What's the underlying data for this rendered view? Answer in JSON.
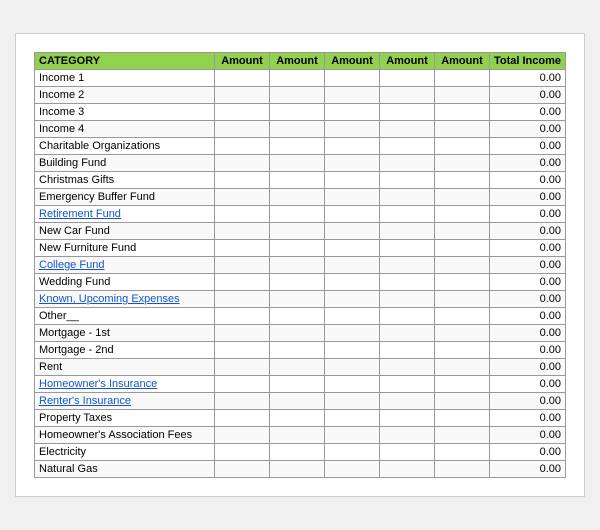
{
  "table": {
    "headers": [
      "CATEGORY",
      "Amount",
      "Amount",
      "Amount",
      "Amount",
      "Amount",
      "Total Income"
    ],
    "rows": [
      {
        "category": "Income 1",
        "link": false,
        "amounts": [
          "",
          "",
          "",
          "",
          ""
        ],
        "total": "0.00"
      },
      {
        "category": "Income 2",
        "link": false,
        "amounts": [
          "",
          "",
          "",
          "",
          ""
        ],
        "total": "0.00"
      },
      {
        "category": "Income 3",
        "link": false,
        "amounts": [
          "",
          "",
          "",
          "",
          ""
        ],
        "total": "0.00"
      },
      {
        "category": "Income 4",
        "link": false,
        "amounts": [
          "",
          "",
          "",
          "",
          ""
        ],
        "total": "0.00"
      },
      {
        "category": "Charitable Organizations",
        "link": false,
        "amounts": [
          "",
          "",
          "",
          "",
          ""
        ],
        "total": "0.00"
      },
      {
        "category": "Building Fund",
        "link": false,
        "amounts": [
          "",
          "",
          "",
          "",
          ""
        ],
        "total": "0.00"
      },
      {
        "category": "Christmas Gifts",
        "link": false,
        "amounts": [
          "",
          "",
          "",
          "",
          ""
        ],
        "total": "0.00"
      },
      {
        "category": "Emergency Buffer Fund",
        "link": false,
        "amounts": [
          "",
          "",
          "",
          "",
          ""
        ],
        "total": "0.00"
      },
      {
        "category": "Retirement Fund",
        "link": true,
        "amounts": [
          "",
          "",
          "",
          "",
          ""
        ],
        "total": "0.00"
      },
      {
        "category": "New Car Fund",
        "link": false,
        "amounts": [
          "",
          "",
          "",
          "",
          ""
        ],
        "total": "0.00"
      },
      {
        "category": "New Furniture Fund",
        "link": false,
        "amounts": [
          "",
          "",
          "",
          "",
          ""
        ],
        "total": "0.00"
      },
      {
        "category": "College Fund",
        "link": true,
        "amounts": [
          "",
          "",
          "",
          "",
          ""
        ],
        "total": "0.00"
      },
      {
        "category": "Wedding Fund",
        "link": false,
        "amounts": [
          "",
          "",
          "",
          "",
          ""
        ],
        "total": "0.00"
      },
      {
        "category": "Known, Upcoming Expenses",
        "link": true,
        "amounts": [
          "",
          "",
          "",
          "",
          ""
        ],
        "total": "0.00"
      },
      {
        "category": "Other__",
        "link": false,
        "amounts": [
          "",
          "",
          "",
          "",
          ""
        ],
        "total": "0.00"
      },
      {
        "category": "Mortgage - 1st",
        "link": false,
        "amounts": [
          "",
          "",
          "",
          "",
          ""
        ],
        "total": "0.00"
      },
      {
        "category": "Mortgage - 2nd",
        "link": false,
        "amounts": [
          "",
          "",
          "",
          "",
          ""
        ],
        "total": "0.00"
      },
      {
        "category": "Rent",
        "link": false,
        "amounts": [
          "",
          "",
          "",
          "",
          ""
        ],
        "total": "0.00"
      },
      {
        "category": "Homeowner's Insurance",
        "link": true,
        "amounts": [
          "",
          "",
          "",
          "",
          ""
        ],
        "total": "0.00"
      },
      {
        "category": "Renter's Insurance",
        "link": true,
        "amounts": [
          "",
          "",
          "",
          "",
          ""
        ],
        "total": "0.00"
      },
      {
        "category": "Property Taxes",
        "link": false,
        "amounts": [
          "",
          "",
          "",
          "",
          ""
        ],
        "total": "0.00"
      },
      {
        "category": "Homeowner's Association Fees",
        "link": false,
        "amounts": [
          "",
          "",
          "",
          "",
          ""
        ],
        "total": "0.00"
      },
      {
        "category": "Electricity",
        "link": false,
        "amounts": [
          "",
          "",
          "",
          "",
          ""
        ],
        "total": "0.00"
      },
      {
        "category": "Natural Gas",
        "link": false,
        "amounts": [
          "",
          "",
          "",
          "",
          ""
        ],
        "total": "0.00"
      }
    ]
  }
}
